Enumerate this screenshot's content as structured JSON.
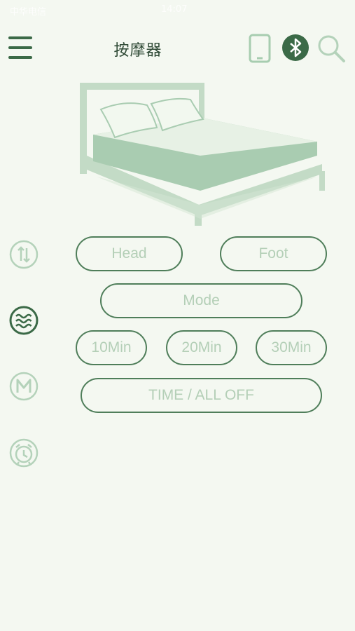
{
  "status_bar": {
    "carrier": "中华电信",
    "time": "14:07"
  },
  "header": {
    "title": "按摩器",
    "menu_icon": "menu-icon",
    "phone_icon": "phone-icon",
    "bluetooth_icon": "bluetooth-icon",
    "search_icon": "search-icon"
  },
  "side_menu": [
    {
      "icon": "up-down-icon",
      "selected": false
    },
    {
      "icon": "waves-icon",
      "selected": true
    },
    {
      "icon": "mode-m-icon",
      "selected": false
    },
    {
      "icon": "alarm-clock-icon",
      "selected": false
    }
  ],
  "controls": {
    "head": "Head",
    "foot": "Foot",
    "mode": "Mode",
    "min10": "10Min",
    "min20": "20Min",
    "min30": "30Min",
    "time_all_off": "TIME / ALL OFF"
  },
  "colors": {
    "background": "#f4f8f1",
    "accent": "#3b6a47",
    "light_accent": "#b4d2ba",
    "button_text": "#b4cfb7"
  }
}
